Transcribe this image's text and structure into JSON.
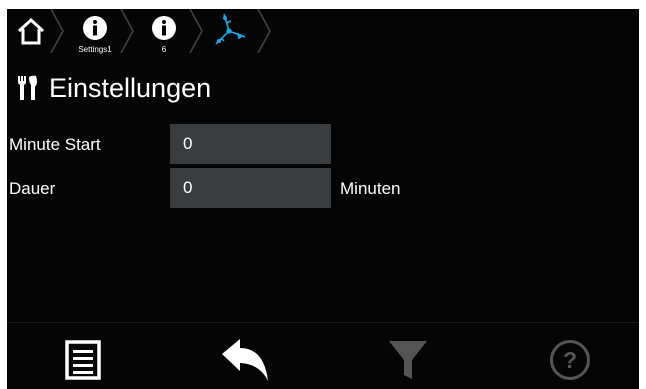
{
  "breadcrumb": {
    "home_icon": "home-icon",
    "items": [
      {
        "icon": "info-icon",
        "sublabel": "Settings1"
      },
      {
        "icon": "info-icon",
        "sublabel": "6"
      },
      {
        "icon": "wind-turbine-icon"
      }
    ]
  },
  "page": {
    "title": "Einstellungen",
    "title_icon": "tools-icon"
  },
  "form": {
    "minute_start_label": "Minute Start",
    "minute_start_value": "0",
    "dauer_label": "Dauer",
    "dauer_value": "0",
    "dauer_unit": "Minuten"
  },
  "bottom_bar": {
    "buttons": [
      "list-icon",
      "back-icon",
      "filter-icon",
      "help-icon"
    ],
    "filter_enabled": false,
    "help_enabled": false
  },
  "colors": {
    "background": "#050505",
    "field_bg": "#3a3d40",
    "accent_turbine": "#1aa7e6",
    "disabled_icon": "#555555"
  }
}
